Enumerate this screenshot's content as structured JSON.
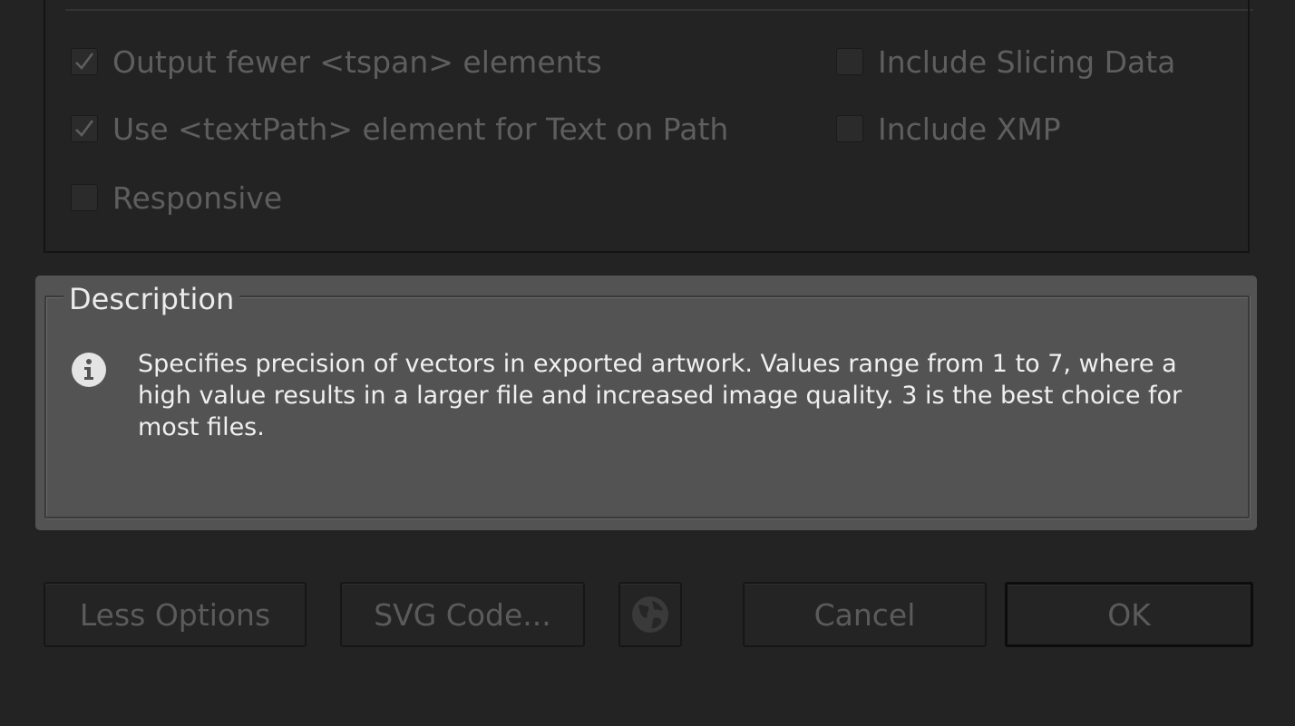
{
  "options": {
    "output_fewer_tspan": {
      "label": "Output fewer <tspan> elements",
      "checked": true
    },
    "use_textpath": {
      "label": "Use <textPath> element for Text on Path",
      "checked": true
    },
    "responsive": {
      "label": "Responsive",
      "checked": false
    },
    "include_slicing_data": {
      "label": "Include Slicing Data",
      "checked": false
    },
    "include_xmp": {
      "label": "Include XMP",
      "checked": false
    }
  },
  "description": {
    "legend": "Description",
    "icon": "info-icon",
    "text": "Specifies precision of vectors in exported artwork. Values range from 1 to 7, where a high value results in a larger file and increased image quality. 3 is the best choice for most files."
  },
  "buttons": {
    "less_options": "Less Options",
    "svg_code": "SVG Code...",
    "globe_icon": "globe-icon",
    "cancel": "Cancel",
    "ok": "OK"
  },
  "colors": {
    "dialog_bg": "#232323",
    "description_bg": "#535353",
    "disabled_text": "#5e5e5e",
    "description_text": "#f0f0f0"
  }
}
